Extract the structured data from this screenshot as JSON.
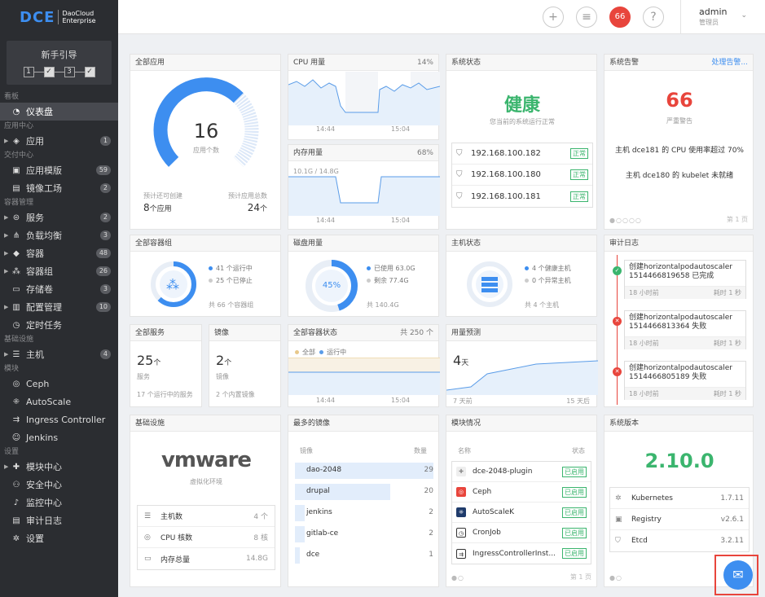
{
  "sidebar": {
    "logo": "DCE",
    "logo_sub1": "DaoCloud",
    "logo_sub2": "Enterprise",
    "guide_title": "新手引导",
    "steps": [
      "1",
      "✓",
      "3",
      "✓"
    ],
    "sections": {
      "dashboard": "看板",
      "apps": "应用中心",
      "delivery": "交付中心",
      "container": "容器管理",
      "infra": "基础设施",
      "modules": "模块",
      "settings": "设置"
    },
    "items": {
      "dashboard": "仪表盘",
      "apps": "应用",
      "app_templates": "应用模版",
      "image_factory": "镜像工场",
      "services": "服务",
      "lb": "负载均衡",
      "containers": "容器",
      "container_groups": "容器组",
      "volumes": "存储卷",
      "config": "配置管理",
      "cron": "定时任务",
      "hosts": "主机",
      "ceph": "Ceph",
      "autoscale": "AutoScale",
      "ingress": "Ingress Controller",
      "jenkins": "Jenkins",
      "module_center": "模块中心",
      "security": "安全中心",
      "monitoring": "监控中心",
      "audit": "审计日志",
      "settings": "设置"
    },
    "badges": {
      "apps": "1",
      "app_templates": "59",
      "image_factory": "2",
      "services": "2",
      "lb": "3",
      "containers": "48",
      "container_groups": "26",
      "volumes": "3",
      "config": "10",
      "hosts": "4"
    }
  },
  "topbar": {
    "alerts": "66",
    "user": "admin",
    "role": "管理员"
  },
  "all_apps": {
    "title": "全部应用",
    "count": "16",
    "count_label": "应用个数",
    "expected_label": "预计还可创建",
    "expected_value": "8",
    "expected_unit": "个应用",
    "total_label": "预计应用总数",
    "total_value": "24",
    "total_unit": "个",
    "fill": 0.667
  },
  "cpu": {
    "title": "CPU 用量",
    "pct": "14%",
    "t1": "14:44",
    "t2": "15:04"
  },
  "mem": {
    "title": "内存用量",
    "pct": "68%",
    "usage": "10.1G / 14.8G",
    "t1": "14:44",
    "t2": "15:04"
  },
  "system_status": {
    "title": "系统状态",
    "status": "健康",
    "sub": "您当前的系统运行正常",
    "nodes": [
      {
        "ip": "192.168.100.182",
        "state": "正常"
      },
      {
        "ip": "192.168.100.180",
        "state": "正常"
      },
      {
        "ip": "192.168.100.181",
        "state": "正常"
      }
    ]
  },
  "alerts": {
    "title": "系统告警",
    "link": "处理告警...",
    "count": "66",
    "label": "严重警告",
    "msg1": "主机 dce181 的 CPU 使用率超过 70%",
    "msg2": "主机 dce180 的 kubelet 未就绪",
    "page": "第 1 页"
  },
  "groups": {
    "title": "全部容器组",
    "running": "41 个运行中",
    "stopped": "25 个已停止",
    "total": "共 66 个容器组",
    "fill": 0.621
  },
  "disk": {
    "title": "磁盘用量",
    "pct_label": "45%",
    "used": "已使用 63.0G",
    "free": "剩余 77.4G",
    "total": "共 140.4G",
    "fill": 0.45
  },
  "host_status": {
    "title": "主机状态",
    "healthy": "4 个健康主机",
    "abnormal": "0 个异常主机",
    "total": "共 4 个主机"
  },
  "audit": {
    "title": "审计日志",
    "entries": [
      {
        "text": "创建horizontalpodautoscaler 1514466819658 已完成",
        "time": "18 小时前",
        "dur": "耗时 1 秒",
        "ok": true
      },
      {
        "text": "创建horizontalpodautoscaler 1514466813364 失败",
        "time": "18 小时前",
        "dur": "耗时 1 秒",
        "ok": false
      },
      {
        "text": "创建horizontalpodautoscaler 1514466805189 失败",
        "time": "18 小时前",
        "dur": "耗时 1 秒",
        "ok": false
      }
    ]
  },
  "services": {
    "title": "全部服务",
    "count": "25",
    "unit": "个",
    "label": "服务",
    "sub": "17 个运行中的服务"
  },
  "images": {
    "title": "镜像",
    "count": "2",
    "unit": "个",
    "label": "镜像",
    "sub": "2 个内置镜像"
  },
  "cstatus": {
    "title": "全部容器状态",
    "total": "共 250 个",
    "all": "全部",
    "running": "运行中",
    "t1": "14:44",
    "t2": "15:04"
  },
  "forecast": {
    "title": "用量预测",
    "days": "4",
    "unit": "天",
    "l": "7 天前",
    "r": "15 天后"
  },
  "infra": {
    "title": "基础设施",
    "vendor": "vmware",
    "vendor_sub": "虚拟化环境",
    "rows": [
      {
        "k": "主机数",
        "v": "4 个"
      },
      {
        "k": "CPU 核数",
        "v": "8 核"
      },
      {
        "k": "内存总量",
        "v": "14.8G"
      }
    ]
  },
  "top_images": {
    "title": "最多的镜像",
    "col1": "镜像",
    "col2": "数量",
    "rows": [
      {
        "name": "dao-2048",
        "count": 29
      },
      {
        "name": "drupal",
        "count": 20
      },
      {
        "name": "jenkins",
        "count": 2
      },
      {
        "name": "gitlab-ce",
        "count": 2
      },
      {
        "name": "dce",
        "count": 1
      }
    ]
  },
  "modules": {
    "title": "模块情况",
    "col1": "名称",
    "col2": "状态",
    "rows": [
      {
        "name": "dce-2048-plugin",
        "state": "已启用"
      },
      {
        "name": "Ceph",
        "state": "已启用"
      },
      {
        "name": "AutoScaleK",
        "state": "已启用"
      },
      {
        "name": "CronJob",
        "state": "已启用"
      },
      {
        "name": "IngressControllerInst...",
        "state": "已启用"
      }
    ],
    "page": "第 1 页"
  },
  "version": {
    "title": "系统版本",
    "ver": "2.10.0",
    "rows": [
      {
        "name": "Kubernetes",
        "v": "1.7.11"
      },
      {
        "name": "Registry",
        "v": "v2.6.1"
      },
      {
        "name": "Etcd",
        "v": "3.2.11"
      }
    ]
  }
}
